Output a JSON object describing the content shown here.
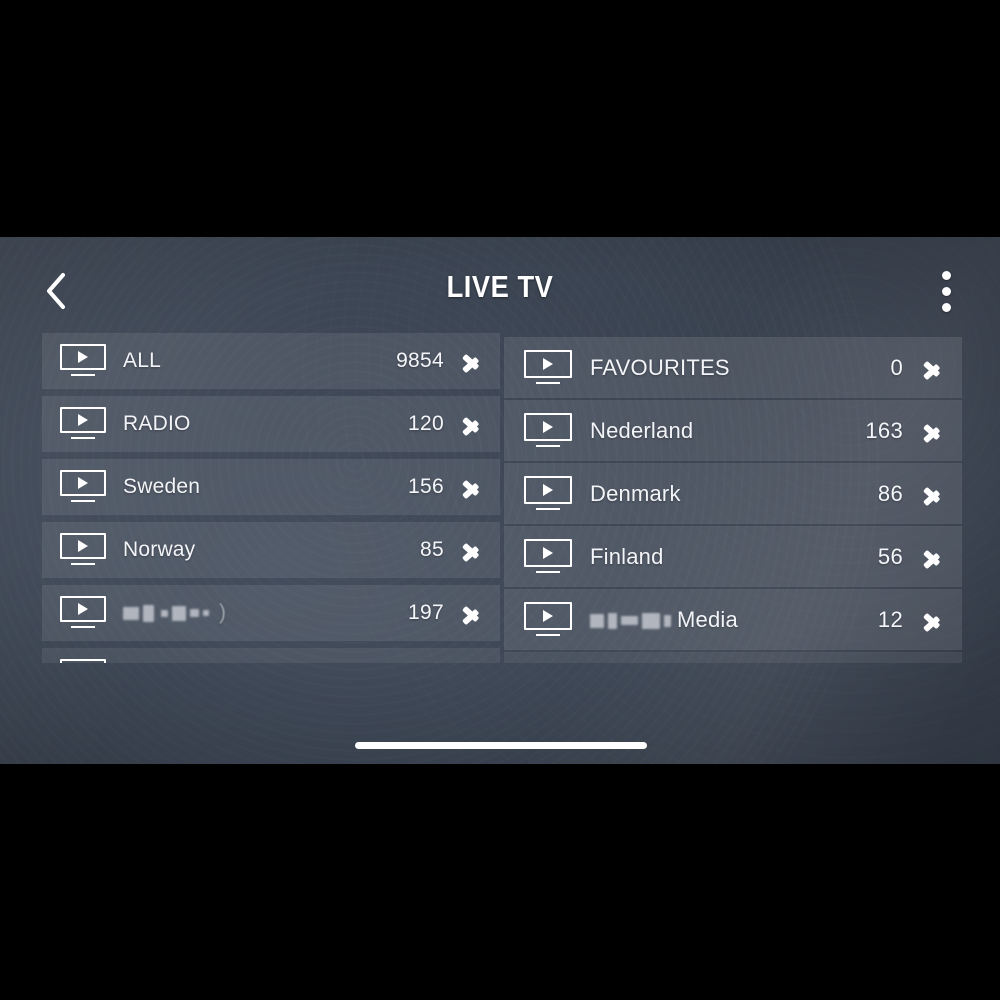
{
  "header": {
    "title": "LIVE TV",
    "back_icon": "chevron-left-icon",
    "menu_icon": "kebab-menu-icon"
  },
  "list": {
    "left_column": [
      {
        "icon": "tv-play-icon",
        "label": "ALL",
        "count": "9854",
        "redacted": false,
        "chevron": "chevron-right-icon"
      },
      {
        "icon": "tv-play-icon",
        "label": "RADIO",
        "count": "120",
        "redacted": false,
        "chevron": "chevron-right-icon"
      },
      {
        "icon": "tv-play-icon",
        "label": "Sweden",
        "count": "156",
        "redacted": false,
        "chevron": "chevron-right-icon"
      },
      {
        "icon": "tv-play-icon",
        "label": "Norway",
        "count": "85",
        "redacted": false,
        "chevron": "chevron-right-icon"
      },
      {
        "icon": "tv-play-icon",
        "label": "",
        "count": "197",
        "redacted": true,
        "chevron": "chevron-right-icon"
      }
    ],
    "right_column": [
      {
        "icon": "tv-play-icon",
        "label": "FAVOURITES",
        "count": "0",
        "redacted": false,
        "chevron": "chevron-right-icon"
      },
      {
        "icon": "tv-play-icon",
        "label": "Nederland",
        "count": "163",
        "redacted": false,
        "chevron": "chevron-right-icon"
      },
      {
        "icon": "tv-play-icon",
        "label": "Denmark",
        "count": "86",
        "redacted": false,
        "chevron": "chevron-right-icon"
      },
      {
        "icon": "tv-play-icon",
        "label": "Finland",
        "count": "56",
        "redacted": false,
        "chevron": "chevron-right-icon"
      },
      {
        "icon": "tv-play-icon",
        "label": "Media",
        "count": "12",
        "redacted": true,
        "chevron": "chevron-right-icon"
      }
    ]
  },
  "system": {
    "home_indicator": "home-indicator-bar"
  },
  "colors": {
    "background": "#3d4654",
    "row_fill": "rgba(255,255,255,0.09)",
    "text": "#f2f4f7",
    "letterbox": "#000000"
  }
}
